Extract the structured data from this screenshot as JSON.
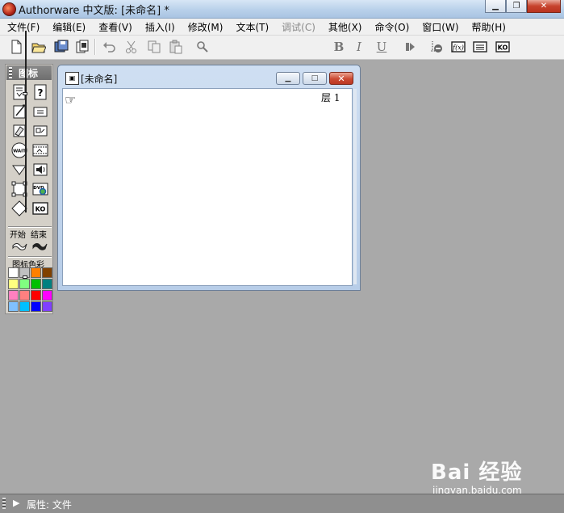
{
  "window": {
    "title": "Authorware 中文版: [未命名] *",
    "minimize_glyph": "▁",
    "restore_glyph": "❐",
    "close_glyph": "✕"
  },
  "menu": [
    {
      "label": "文件(F)",
      "enabled": true
    },
    {
      "label": "编辑(E)",
      "enabled": true
    },
    {
      "label": "查看(V)",
      "enabled": true
    },
    {
      "label": "插入(I)",
      "enabled": true
    },
    {
      "label": "修改(M)",
      "enabled": true
    },
    {
      "label": "文本(T)",
      "enabled": true
    },
    {
      "label": "调试(C)",
      "enabled": false
    },
    {
      "label": "其他(X)",
      "enabled": true
    },
    {
      "label": "命令(O)",
      "enabled": true
    },
    {
      "label": "窗口(W)",
      "enabled": true
    },
    {
      "label": "帮助(H)",
      "enabled": true
    }
  ],
  "toolbar": {
    "font_value": "",
    "bold": "B",
    "italic": "I",
    "underline": "U",
    "icons": [
      "new-file-icon",
      "open-file-icon",
      "save-all-icon",
      "import-icon",
      "undo-icon",
      "cut-icon",
      "copy-icon",
      "paste-icon",
      "find-icon",
      "run-icon",
      "control-panel-icon",
      "functions-icon",
      "variables-icon",
      "knowledge-objects-icon"
    ]
  },
  "palette": {
    "title": "图标",
    "start_label": "开始",
    "end_label": "结束",
    "color_label": "图标色彩",
    "icons": [
      "display-icon",
      "interaction-icon",
      "motion-icon",
      "calculation-icon",
      "erase-icon",
      "map-icon",
      "wait-icon",
      "digital-movie-icon",
      "navigate-icon",
      "sound-icon",
      "framework-icon",
      "dvd-icon",
      "decision-icon",
      "ko-icon"
    ],
    "wait_text": "WAIT",
    "dvd_text": "DVD",
    "ko_text": "KO",
    "colors": [
      "#ffffff",
      "#c0c0c0",
      "#ff8000",
      "#804000",
      "#ffff80",
      "#80ff80",
      "#00c000",
      "#008080",
      "#ff80c0",
      "#ff8080",
      "#ff0000",
      "#ff00ff",
      "#80c0ff",
      "#00c0ff",
      "#0000ff",
      "#8040ff"
    ]
  },
  "design_window": {
    "title": "[未命名]",
    "layer_label": "层 1",
    "min_glyph": "▁",
    "max_glyph": "□",
    "close_glyph": "✕"
  },
  "watermark": {
    "brand": "Bai 经验",
    "url": "jingyan.baidu.com"
  },
  "properties_bar": {
    "arrow": "▶",
    "label": "属性: 文件"
  }
}
